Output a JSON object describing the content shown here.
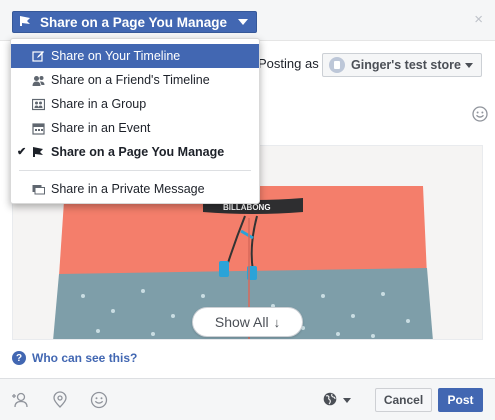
{
  "header": {
    "share_label": "Share on a Page You Manage",
    "close_symbol": "×"
  },
  "posting": {
    "label": "Posting as",
    "page_name": "Ginger's test store"
  },
  "menu": {
    "items": [
      {
        "label": "Share on Your Timeline",
        "icon": "edit-icon",
        "state": "highlighted"
      },
      {
        "label": "Share on a Friend's Timeline",
        "icon": "friends-icon",
        "state": "normal"
      },
      {
        "label": "Share in a Group",
        "icon": "group-icon",
        "state": "normal"
      },
      {
        "label": "Share in an Event",
        "icon": "calendar-icon",
        "state": "normal"
      },
      {
        "label": "Share on a Page You Manage",
        "icon": "page-flag-icon",
        "state": "checked"
      },
      {
        "label": "Share in a Private Message",
        "icon": "message-icon",
        "state": "normal"
      }
    ],
    "check_symbol": "✔"
  },
  "attachment": {
    "show_all_label": "Show All",
    "show_all_arrow": "↓",
    "brand_text": "BILLABONG"
  },
  "privacy": {
    "help_symbol": "?",
    "who_label": "Who can see this?"
  },
  "footer": {
    "cancel_label": "Cancel",
    "post_label": "Post",
    "icons": [
      "tag-friends-icon",
      "location-pin-icon",
      "emoji-icon",
      "globe-icon"
    ]
  },
  "colors": {
    "accent": "#4267b2",
    "shorts_coral": "#f47e6b",
    "shorts_teal": "#7e9ea9"
  }
}
